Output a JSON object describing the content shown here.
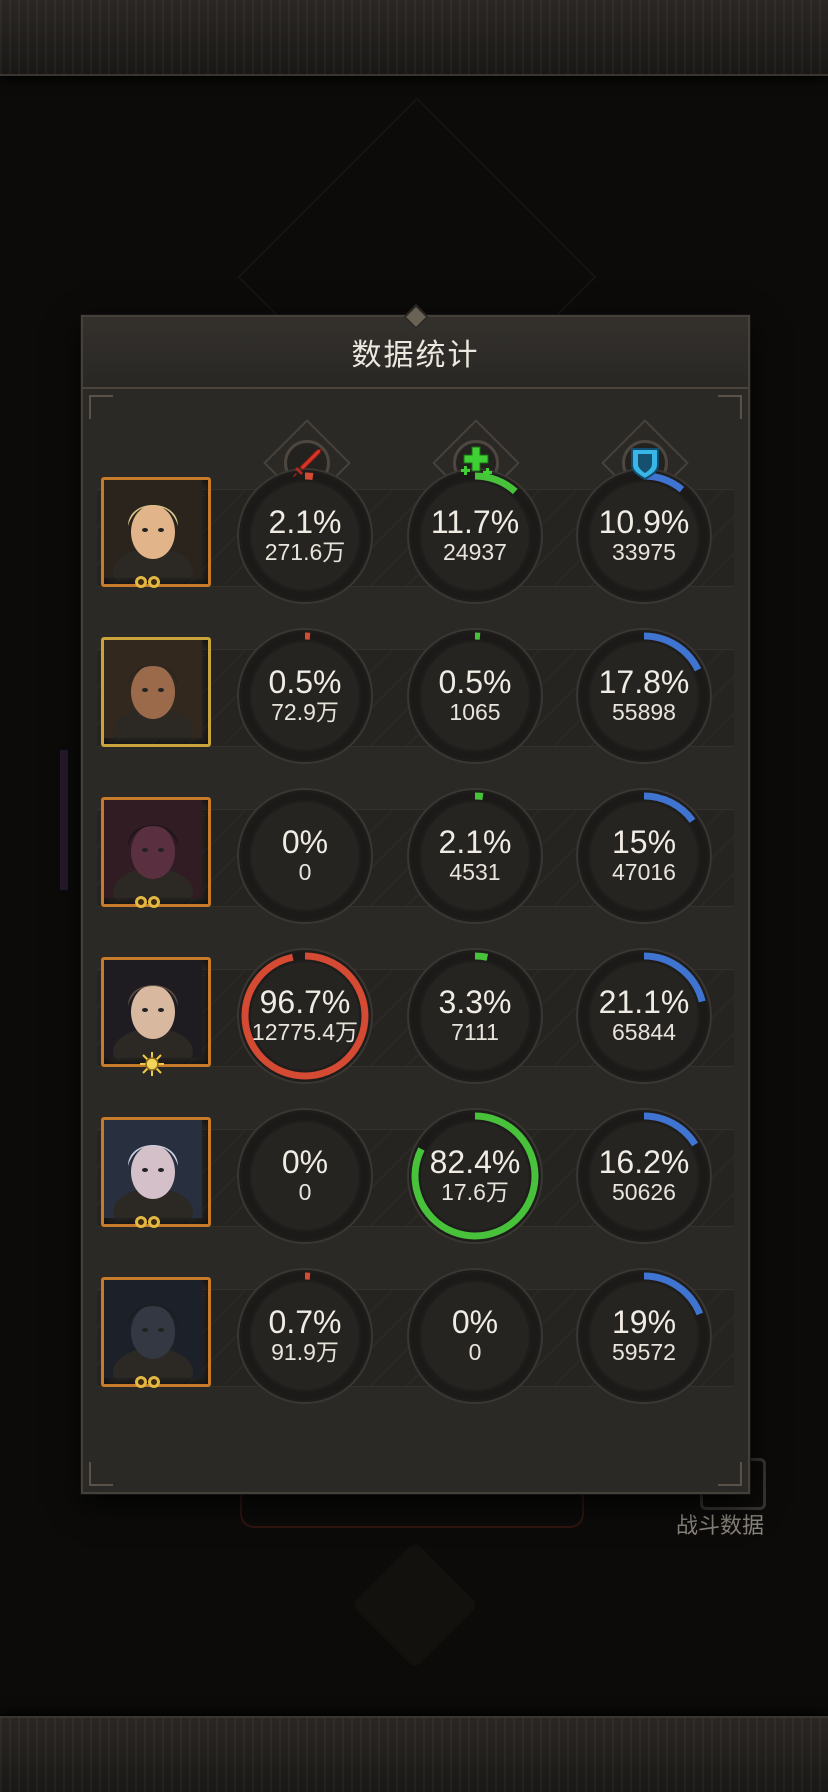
{
  "panel": {
    "title": "数据统计"
  },
  "background": {
    "battle_data_label": "战斗数据"
  },
  "columns": [
    {
      "key": "damage",
      "icon": "sword-icon",
      "color": "#d23a2a"
    },
    {
      "key": "healing",
      "icon": "heal-cross-icon",
      "color": "#43c23a"
    },
    {
      "key": "defense",
      "icon": "shield-icon",
      "color": "#3f78d6"
    }
  ],
  "colors": {
    "damage": "#d44a32",
    "healing": "#48c23b",
    "defense": "#3f74d0",
    "track": "#1b1a18"
  },
  "heroes": [
    {
      "name": "hero-1",
      "avatar_frame": "orange",
      "badge": "rings",
      "damage": {
        "pct": "2.1%",
        "value": "271.6万",
        "fraction": 0.021
      },
      "healing": {
        "pct": "11.7%",
        "value": "24937",
        "fraction": 0.117
      },
      "defense": {
        "pct": "10.9%",
        "value": "33975",
        "fraction": 0.109
      }
    },
    {
      "name": "hero-2",
      "avatar_frame": "gold",
      "badge": "none",
      "damage": {
        "pct": "0.5%",
        "value": "72.9万",
        "fraction": 0.005
      },
      "healing": {
        "pct": "0.5%",
        "value": "1065",
        "fraction": 0.005
      },
      "defense": {
        "pct": "17.8%",
        "value": "55898",
        "fraction": 0.178
      }
    },
    {
      "name": "hero-3",
      "avatar_frame": "orange",
      "badge": "rings",
      "damage": {
        "pct": "0%",
        "value": "0",
        "fraction": 0
      },
      "healing": {
        "pct": "2.1%",
        "value": "4531",
        "fraction": 0.021
      },
      "defense": {
        "pct": "15%",
        "value": "47016",
        "fraction": 0.15
      }
    },
    {
      "name": "hero-4",
      "avatar_frame": "orange",
      "badge": "sun",
      "damage": {
        "pct": "96.7%",
        "value": "12775.4万",
        "fraction": 0.967
      },
      "healing": {
        "pct": "3.3%",
        "value": "7111",
        "fraction": 0.033
      },
      "defense": {
        "pct": "21.1%",
        "value": "65844",
        "fraction": 0.211
      }
    },
    {
      "name": "hero-5",
      "avatar_frame": "orange",
      "badge": "rings",
      "damage": {
        "pct": "0%",
        "value": "0",
        "fraction": 0
      },
      "healing": {
        "pct": "82.4%",
        "value": "17.6万",
        "fraction": 0.824
      },
      "defense": {
        "pct": "16.2%",
        "value": "50626",
        "fraction": 0.162
      }
    },
    {
      "name": "hero-6",
      "avatar_frame": "orange",
      "badge": "rings",
      "damage": {
        "pct": "0.7%",
        "value": "91.9万",
        "fraction": 0.007
      },
      "healing": {
        "pct": "0%",
        "value": "0",
        "fraction": 0
      },
      "defense": {
        "pct": "19%",
        "value": "59572",
        "fraction": 0.19
      }
    }
  ]
}
